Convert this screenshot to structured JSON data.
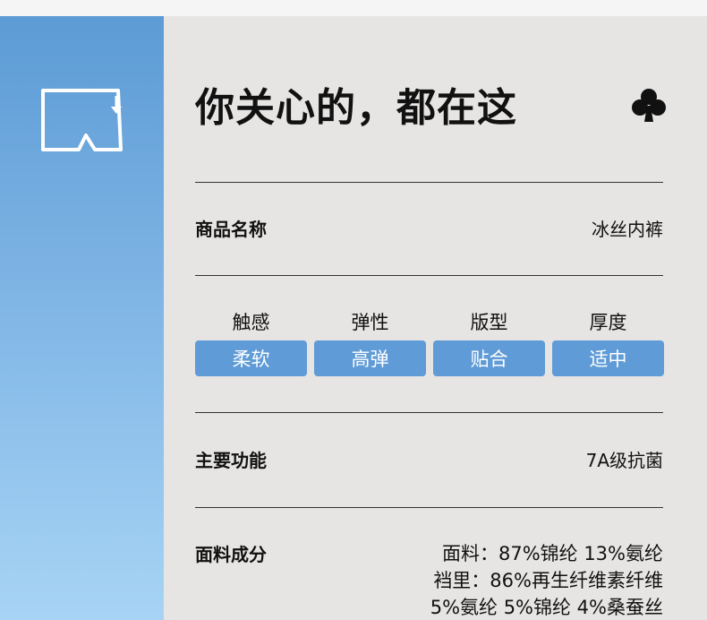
{
  "product_card": {
    "title": "你关心的，都在这",
    "icons": {
      "shorts": "shorts-outline-icon",
      "club": "club-suit-icon"
    },
    "colors": {
      "accent_blue": "#5f9bd6",
      "sidebar_top": "#5c9bd5",
      "sidebar_bottom": "#a7d4f5",
      "panel_bg": "#e6e5e3"
    },
    "product_name": {
      "label": "商品名称",
      "value": "冰丝内裤"
    },
    "attributes": [
      {
        "name": "触感",
        "value": "柔软"
      },
      {
        "name": "弹性",
        "value": "高弹"
      },
      {
        "name": "版型",
        "value": "贴合"
      },
      {
        "name": "厚度",
        "value": "适中"
      }
    ],
    "main_function": {
      "label": "主要功能",
      "value": "7A级抗菌"
    },
    "fabric": {
      "label": "面料成分",
      "lines": [
        "面料：87%锦纶 13%氨纶",
        "裆里：86%再生纤维素纤维",
        "5%氨纶 5%锦纶 4%桑蚕丝"
      ]
    }
  }
}
